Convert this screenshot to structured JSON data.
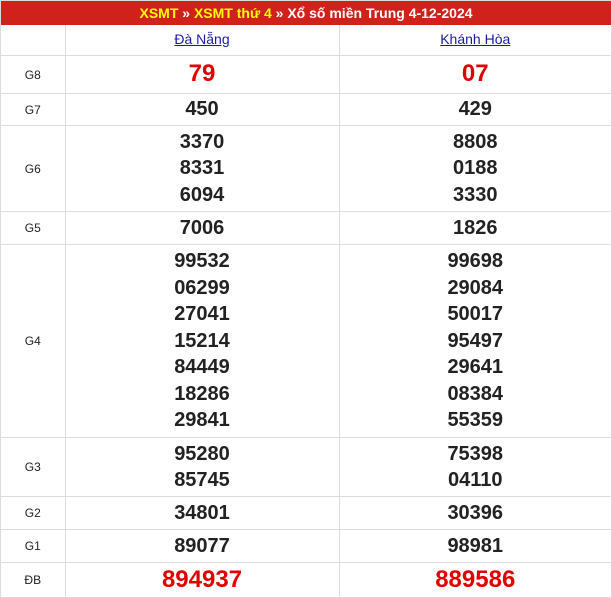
{
  "breadcrumb": {
    "link1": "XSMT",
    "link2": "XSMT thứ 4",
    "sep": "»",
    "title": "Xổ số miền Trung 4-12-2024"
  },
  "provinces": [
    "Đà Nẵng",
    "Khánh Hòa"
  ],
  "prizes": {
    "g8": {
      "label": "G8",
      "values": [
        [
          "79"
        ],
        [
          "07"
        ]
      ]
    },
    "g7": {
      "label": "G7",
      "values": [
        [
          "450"
        ],
        [
          "429"
        ]
      ]
    },
    "g6": {
      "label": "G6",
      "values": [
        [
          "3370",
          "8331",
          "6094"
        ],
        [
          "8808",
          "0188",
          "3330"
        ]
      ]
    },
    "g5": {
      "label": "G5",
      "values": [
        [
          "7006"
        ],
        [
          "1826"
        ]
      ]
    },
    "g4": {
      "label": "G4",
      "values": [
        [
          "99532",
          "06299",
          "27041",
          "15214",
          "84449",
          "18286",
          "29841"
        ],
        [
          "99698",
          "29084",
          "50017",
          "95497",
          "29641",
          "08384",
          "55359"
        ]
      ]
    },
    "g3": {
      "label": "G3",
      "values": [
        [
          "95280",
          "85745"
        ],
        [
          "75398",
          "04110"
        ]
      ]
    },
    "g2": {
      "label": "G2",
      "values": [
        [
          "34801"
        ],
        [
          "30396"
        ]
      ]
    },
    "g1": {
      "label": "G1",
      "values": [
        [
          "89077"
        ],
        [
          "98981"
        ]
      ]
    },
    "db": {
      "label": "ĐB",
      "values": [
        [
          "894937"
        ],
        [
          "889586"
        ]
      ]
    }
  },
  "colors": {
    "header_bg": "#d0211b",
    "link_yellow": "#ffff00",
    "prize_red": "#e00000",
    "province_link": "#1a1aa6"
  }
}
